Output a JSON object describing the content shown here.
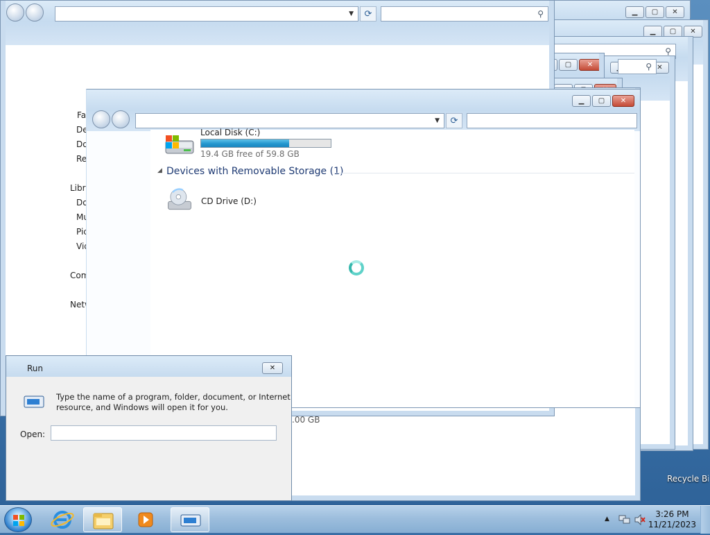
{
  "sidebar": {
    "items": [
      "Fav",
      "Desktop",
      "Downloads",
      "Recent Places",
      "Libraries",
      "Documents",
      "Music",
      "Pictures",
      "Videos",
      "Computer",
      "Network"
    ]
  },
  "main": {
    "drives": [
      {
        "name": "Local Disk (C:)",
        "free_text": "19.4 GB free of 59.8 GB",
        "used_fraction": 0.68
      }
    ],
    "removable_group": "Devices with Removable Storage (1)",
    "removable": [
      {
        "name": "CD Drive (D:)"
      }
    ],
    "background_text": ".00 GB"
  },
  "run_dialog": {
    "title": "Run",
    "description_line1": "Type the name of a program, folder, document, or Internet",
    "description_line2": "resource, and Windows will open it for you.",
    "open_label": "Open:"
  },
  "desktop": {
    "recycle_bin_label": "Recycle Bin"
  },
  "taskbar": {
    "time": "3:26 PM",
    "date": "11/21/2023"
  },
  "colors": {
    "accent": "#1f73c6",
    "progress": "#2597cf",
    "close_button": "#c44a35"
  }
}
